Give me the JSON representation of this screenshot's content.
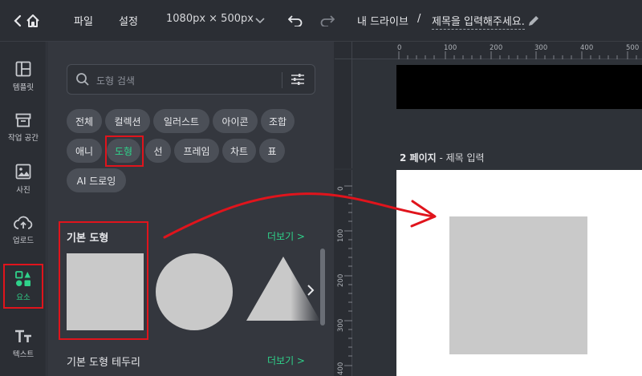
{
  "topbar": {
    "file_menu": "파일",
    "settings_menu": "설정",
    "canvas_size": "1080px × 500px",
    "breadcrumb_drive": "내 드라이브",
    "breadcrumb_sep": "/",
    "document_title": "제목을 입력해주세요."
  },
  "rail": {
    "items": [
      {
        "label": "템플릿",
        "icon": "template-icon"
      },
      {
        "label": "작업 공간",
        "icon": "workspace-icon"
      },
      {
        "label": "사진",
        "icon": "photo-icon"
      },
      {
        "label": "업로드",
        "icon": "upload-icon"
      },
      {
        "label": "요소",
        "icon": "elements-icon",
        "active": true
      },
      {
        "label": "텍스트",
        "icon": "text-icon"
      }
    ]
  },
  "panel": {
    "search_placeholder": "도형 검색",
    "chips": [
      "전체",
      "컬렉션",
      "일러스트",
      "아이콘",
      "조합",
      "애니",
      "도형",
      "선",
      "프레임",
      "차트",
      "표",
      "AI 드로잉"
    ],
    "selected_chip": "도형",
    "section1_title": "기본 도형",
    "section1_more": "더보기 >",
    "section2_title": "기본 도형 테두리",
    "section2_more": "더보기 >"
  },
  "canvas": {
    "ruler_h": [
      "0",
      "100",
      "200",
      "300",
      "400",
      "500"
    ],
    "ruler_v": [
      "0",
      "100",
      "200",
      "300",
      "400"
    ],
    "page2_number": "2 페이지",
    "page2_dash": " - ",
    "page2_title": "제목 입력"
  },
  "colors": {
    "accent": "#2fd28a",
    "highlight": "#e0141c",
    "shape_fill": "#c9c9c9"
  }
}
